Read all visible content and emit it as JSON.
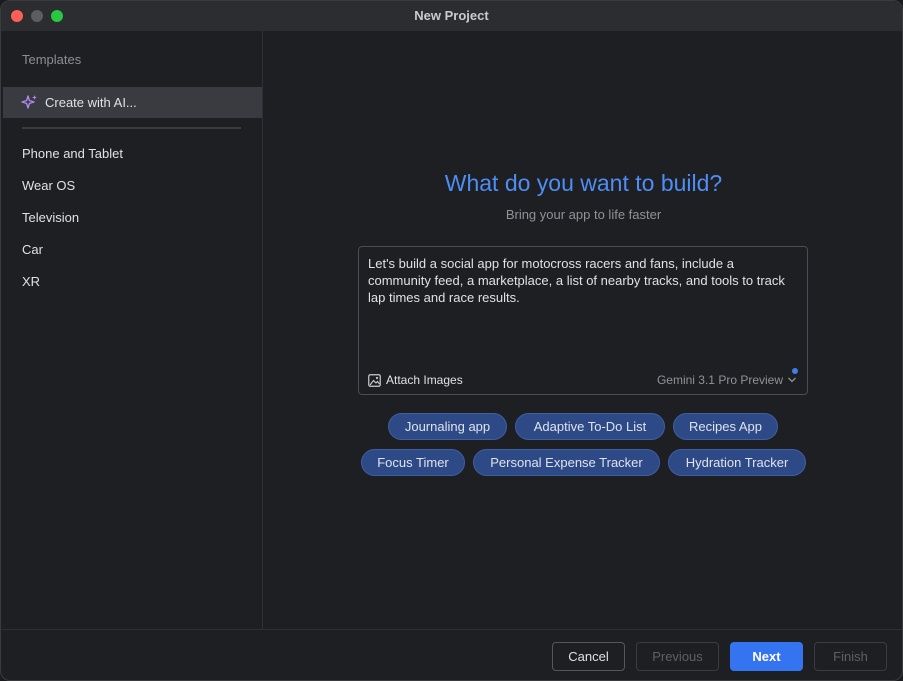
{
  "window": {
    "title": "New Project"
  },
  "sidebar": {
    "heading": "Templates",
    "ai_item": {
      "label": "Create with AI...",
      "icon": "sparkle-icon"
    },
    "items": [
      {
        "label": "Phone and Tablet"
      },
      {
        "label": "Wear OS"
      },
      {
        "label": "Television"
      },
      {
        "label": "Car"
      },
      {
        "label": "XR"
      }
    ]
  },
  "main": {
    "title": "What do you want to build?",
    "subtitle": "Bring your app to life faster",
    "prompt": {
      "value": "Let's build a social app for motocross racers and fans, include a community feed, a marketplace, a list of nearby tracks, and tools to track lap times and race results.",
      "attach_label": "Attach Images",
      "attach_icon": "image-icon",
      "model_label": "Gemini 3.1 Pro Preview"
    },
    "suggestions": [
      "Journaling app",
      "Adaptive To-Do List",
      "Recipes App",
      "Focus Timer",
      "Personal Expense Tracker",
      "Hydration Tracker"
    ]
  },
  "footer": {
    "cancel": "Cancel",
    "previous": "Previous",
    "next": "Next",
    "finish": "Finish"
  },
  "colors": {
    "accent": "#3574f0",
    "title_blue": "#4d8df5",
    "chip_bg": "#2e4a86",
    "background": "#1e1f22"
  }
}
